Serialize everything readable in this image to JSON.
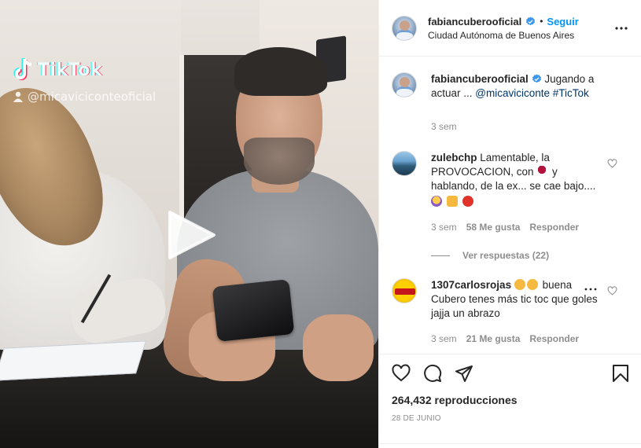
{
  "video": {
    "watermark_brand": "TikTok",
    "watermark_handle": "@micaviciconteoficial"
  },
  "header": {
    "username": "fabiancuberooficial",
    "separator": "•",
    "follow_label": "Seguir",
    "location": "Ciudad Autónoma de Buenos Aires"
  },
  "caption": {
    "username": "fabiancuberooficial",
    "text": "Jugando a actuar ... ",
    "mention": "@micaviciconte",
    "hashtag": "#TicTok",
    "time": "3 sem"
  },
  "comments": [
    {
      "username": "zulebchp",
      "text": "Lamentable, la PROVOCACION, con ",
      "text2": " y hablando, de la ex... se cae bajo....",
      "time": "3 sem",
      "likes": "58 Me gusta",
      "reply_label": "Responder",
      "view_replies": "Ver respuestas (22)"
    },
    {
      "username": "1307carlosrojas",
      "text": " buena Cubero tenes más tic toc que goles jajja un abrazo",
      "time": "3 sem",
      "likes": "21 Me gusta",
      "reply_label": "Responder"
    }
  ],
  "footer": {
    "views": "264,432 reproducciones",
    "date": "28 de junio"
  },
  "colors": {
    "link": "#00376b",
    "follow": "#0095f6",
    "muted": "#8e8e8e",
    "verified": "#3897f0"
  },
  "icons": [
    "tiktok-icon",
    "user-icon",
    "play-icon",
    "verified-icon",
    "more-icon",
    "heart-icon",
    "comment-icon",
    "share-icon",
    "bookmark-icon"
  ]
}
